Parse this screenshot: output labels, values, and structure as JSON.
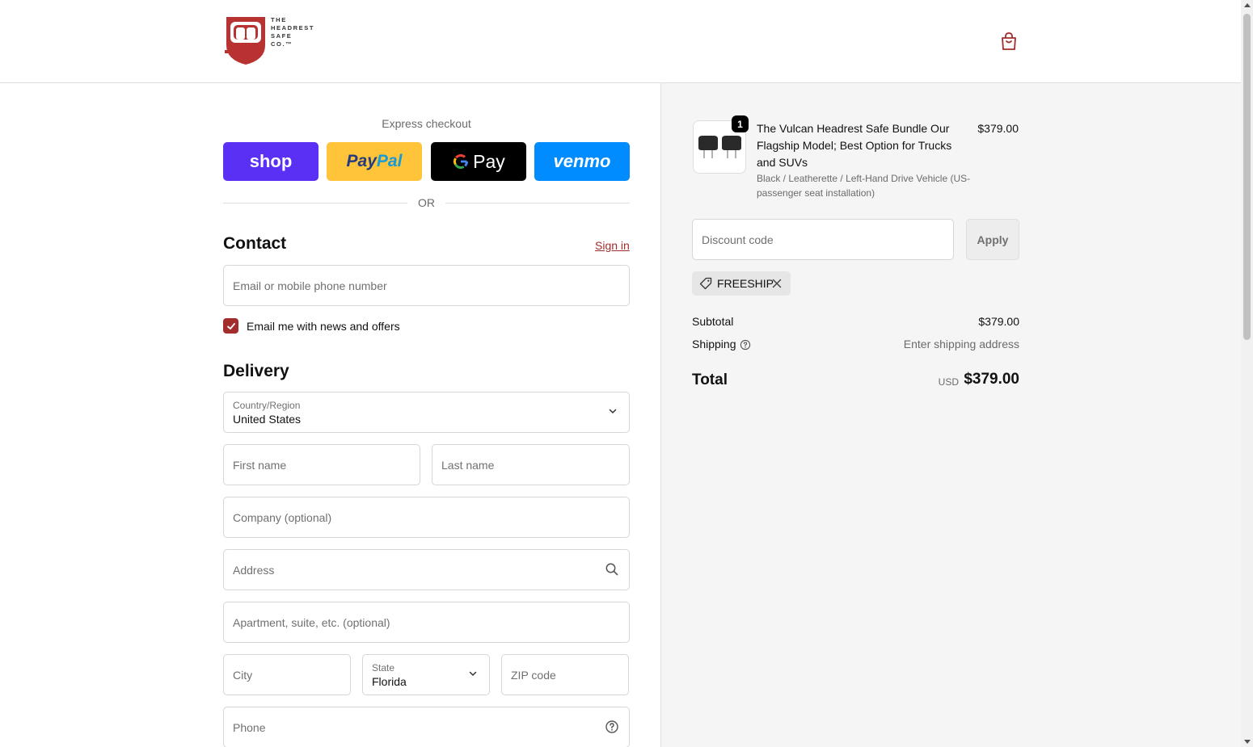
{
  "brand": {
    "logo_text": [
      "THE",
      "HEADREST",
      "SAFE",
      "CO.™"
    ],
    "logo_color": "#b83232"
  },
  "header": {
    "cart_icon": "shopping-bag-icon"
  },
  "express": {
    "label": "Express checkout",
    "buttons": {
      "shop": "shop",
      "paypal_part1": "Pay",
      "paypal_part2": "Pal",
      "gpay": "Pay",
      "venmo": "venmo"
    },
    "or_label": "OR"
  },
  "contact": {
    "title": "Contact",
    "sign_in": "Sign in",
    "email_placeholder": "Email or mobile phone number",
    "newsletter_label": "Email me with news and offers",
    "newsletter_checked": true
  },
  "delivery": {
    "title": "Delivery",
    "country_label": "Country/Region",
    "country_value": "United States",
    "first_name_placeholder": "First name",
    "last_name_placeholder": "Last name",
    "company_placeholder": "Company (optional)",
    "address_placeholder": "Address",
    "apartment_placeholder": "Apartment, suite, etc. (optional)",
    "city_placeholder": "City",
    "state_label": "State",
    "state_value": "Florida",
    "zip_placeholder": "ZIP code",
    "phone_placeholder": "Phone"
  },
  "order": {
    "item": {
      "quantity": "1",
      "title": "The Vulcan Headrest Safe Bundle Our Flagship Model; Best Option for Trucks and SUVs",
      "variant": "Black / Leatherette / Left-Hand Drive Vehicle (US-passenger seat installation)",
      "price": "$379.00"
    },
    "discount_placeholder": "Discount code",
    "apply_label": "Apply",
    "applied_code": "FREESHIP",
    "subtotal_label": "Subtotal",
    "subtotal_value": "$379.00",
    "shipping_label": "Shipping",
    "shipping_value": "Enter shipping address",
    "total_label": "Total",
    "total_currency": "USD",
    "total_value": "$379.00"
  },
  "colors": {
    "accent": "#a32c2c",
    "shop": "#5a31f4",
    "paypal": "#ffc439",
    "venmo": "#008cff",
    "sidebar_bg": "#f5f5f5"
  }
}
